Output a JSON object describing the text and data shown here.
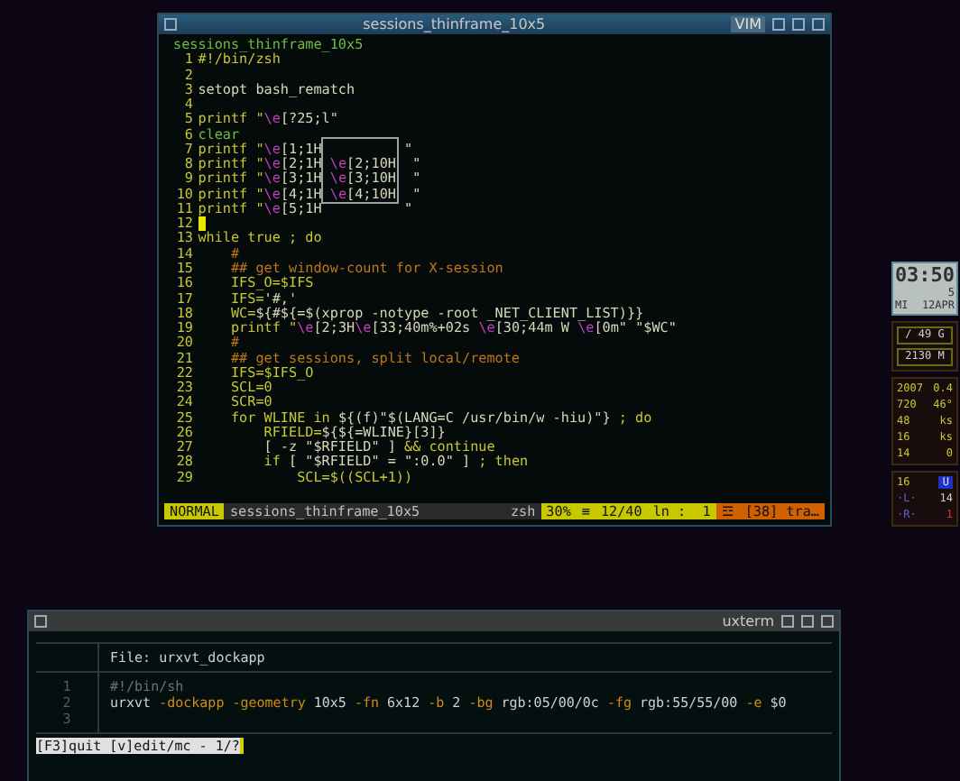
{
  "vim_window": {
    "title": "sessions_thinframe_10x5",
    "app_label": "VIM",
    "buffer_name": "sessions_thinframe_10x5",
    "lines": [
      {
        "number": "1",
        "cursor": false,
        "segments": [
          {
            "text": "#!/bin/zsh",
            "color": "#c8c832"
          }
        ]
      },
      {
        "number": "2",
        "cursor": false
      },
      {
        "number": "3",
        "cursor": false,
        "segments": [
          {
            "text": "setopt bash_rematch",
            "color": "#d8d8b8"
          }
        ]
      },
      {
        "number": "4",
        "cursor": false
      },
      {
        "number": "5",
        "cursor": false,
        "segments": [
          {
            "text": "printf \"",
            "color": "#c8c832"
          },
          {
            "text": "\\e",
            "color": "#c040c0"
          },
          {
            "text": "[?25;l\"",
            "color": "#d8d8b8"
          }
        ]
      },
      {
        "number": "6",
        "cursor": false,
        "segments": [
          {
            "text": "clear",
            "color": "#70c040"
          }
        ]
      },
      {
        "number": "7",
        "cursor": false,
        "segments": [
          {
            "text": "printf \"",
            "color": "#c8c832"
          },
          {
            "text": "\\e",
            "color": "#c040c0"
          },
          {
            "text": "[1;1H          \"",
            "color": "#d8d8b8"
          }
        ]
      },
      {
        "number": "8",
        "cursor": false,
        "segments": [
          {
            "text": "printf \"",
            "color": "#c8c832"
          },
          {
            "text": "\\e",
            "color": "#c040c0"
          },
          {
            "text": "[2;1H ",
            "color": "#d8d8b8"
          },
          {
            "text": "\\e",
            "color": "#c040c0"
          },
          {
            "text": "[2;10H  \"",
            "color": "#d8d8b8"
          }
        ]
      },
      {
        "number": "9",
        "cursor": false,
        "segments": [
          {
            "text": "printf \"",
            "color": "#c8c832"
          },
          {
            "text": "\\e",
            "color": "#c040c0"
          },
          {
            "text": "[3;1H ",
            "color": "#d8d8b8"
          },
          {
            "text": "\\e",
            "color": "#c040c0"
          },
          {
            "text": "[3;10H  \"",
            "color": "#d8d8b8"
          }
        ]
      },
      {
        "number": "10",
        "cursor": false,
        "segments": [
          {
            "text": "printf \"",
            "color": "#c8c832"
          },
          {
            "text": "\\e",
            "color": "#c040c0"
          },
          {
            "text": "[4;1H ",
            "color": "#d8d8b8"
          },
          {
            "text": "\\e",
            "color": "#c040c0"
          },
          {
            "text": "[4;10H  \"",
            "color": "#d8d8b8"
          }
        ]
      },
      {
        "number": "11",
        "cursor": false,
        "segments": [
          {
            "text": "printf \"",
            "color": "#c8c832"
          },
          {
            "text": "\\e",
            "color": "#c040c0"
          },
          {
            "text": "[5;1H          \"",
            "color": "#d8d8b8"
          }
        ]
      },
      {
        "number": "12",
        "cursor": true
      },
      {
        "number": "13",
        "cursor": false,
        "segments": [
          {
            "text": "while true ; do",
            "color": "#c8c832"
          }
        ]
      },
      {
        "number": "14",
        "cursor": false,
        "segments": [
          {
            "text": "    #",
            "color": "#c07818"
          }
        ]
      },
      {
        "number": "15",
        "cursor": false,
        "segments": [
          {
            "text": "    ## get window-count for X-session",
            "color": "#c07818"
          }
        ]
      },
      {
        "number": "16",
        "cursor": false,
        "segments": [
          {
            "text": "    IFS_O=$IFS",
            "color": "#c8c832"
          }
        ]
      },
      {
        "number": "17",
        "cursor": false,
        "segments": [
          {
            "text": "    IFS=",
            "color": "#c8c832"
          },
          {
            "text": "'#,'",
            "color": "#d8d8b8"
          }
        ]
      },
      {
        "number": "18",
        "cursor": false,
        "segments": [
          {
            "text": "    WC=",
            "color": "#c8c832"
          },
          {
            "text": "${#${=$(xprop -notype -root _NET_CLIENT_LIST)}}",
            "color": "#d8d8b8"
          }
        ]
      },
      {
        "number": "19",
        "cursor": false,
        "segments": [
          {
            "text": "    printf \"",
            "color": "#c8c832"
          },
          {
            "text": "\\e",
            "color": "#c040c0"
          },
          {
            "text": "[2;3H",
            "color": "#d8d8b8"
          },
          {
            "text": "\\e",
            "color": "#c040c0"
          },
          {
            "text": "[33;40m%+02s ",
            "color": "#d8d8b8"
          },
          {
            "text": "\\e",
            "color": "#c040c0"
          },
          {
            "text": "[30;44m W ",
            "color": "#d8d8b8"
          },
          {
            "text": "\\e",
            "color": "#c040c0"
          },
          {
            "text": "[0m\" \"$WC\"",
            "color": "#d8d8b8"
          }
        ]
      },
      {
        "number": "20",
        "cursor": false,
        "segments": [
          {
            "text": "    #",
            "color": "#c07818"
          }
        ]
      },
      {
        "number": "21",
        "cursor": false,
        "segments": [
          {
            "text": "    ## get sessions, split local/remote",
            "color": "#c07818"
          }
        ]
      },
      {
        "number": "22",
        "cursor": false,
        "segments": [
          {
            "text": "    IFS=$IFS_O",
            "color": "#c8c832"
          }
        ]
      },
      {
        "number": "23",
        "cursor": false,
        "segments": [
          {
            "text": "    SCL=0",
            "color": "#c8c832"
          }
        ]
      },
      {
        "number": "24",
        "cursor": false,
        "segments": [
          {
            "text": "    SCR=0",
            "color": "#c8c832"
          }
        ]
      },
      {
        "number": "25",
        "cursor": false,
        "segments": [
          {
            "text": "    for WLINE in ",
            "color": "#c8c832"
          },
          {
            "text": "${(f)\"$(LANG=C /usr/bin/w -hiu)\"}",
            "color": "#d8d8b8"
          },
          {
            "text": " ; do",
            "color": "#c8c832"
          }
        ]
      },
      {
        "number": "26",
        "cursor": false,
        "segments": [
          {
            "text": "        RFIELD=",
            "color": "#c8c832"
          },
          {
            "text": "${${=WLINE}[3]}",
            "color": "#d8d8b8"
          }
        ]
      },
      {
        "number": "27",
        "cursor": false,
        "segments": [
          {
            "text": "        [ -z \"$RFIELD\" ] ",
            "color": "#d8d8b8"
          },
          {
            "text": "&& continue",
            "color": "#c8c832"
          }
        ]
      },
      {
        "number": "28",
        "cursor": false,
        "segments": [
          {
            "text": "        if ",
            "color": "#c8c832"
          },
          {
            "text": "[ \"$RFIELD\" = \":0.0\" ] ",
            "color": "#d8d8b8"
          },
          {
            "text": "; then",
            "color": "#c8c832"
          }
        ]
      },
      {
        "number": "29",
        "cursor": false,
        "segments": [
          {
            "text": "            SCL=$((SCL+1))",
            "color": "#c8c832"
          }
        ]
      }
    ],
    "status_bar": {
      "mode": "NORMAL",
      "file": "sessions_thinframe_10x5",
      "filetype": "zsh",
      "percent": "30%",
      "percent_icon": "≡",
      "position": "12/40",
      "line_col": "ln :  1",
      "warning_icon": "☲",
      "warning": "[38] tra…"
    }
  },
  "dock": {
    "clock": {
      "time": "03:50",
      "seconds": "5",
      "day": "MI",
      "date": "12APR"
    },
    "disk": [
      "/ 49 G",
      "2130 M"
    ],
    "stats": [
      [
        "2007",
        "0.4"
      ],
      [
        "720",
        "46°"
      ],
      [
        "48",
        "ks"
      ],
      [
        "16",
        "ks"
      ],
      [
        "14",
        "0"
      ]
    ],
    "sessions": {
      "count": "16",
      "badge": "U",
      "local_label": "·L·",
      "local": "14",
      "remote_label": "·R·",
      "remote": "1"
    }
  },
  "uxterm_window": {
    "title": "uxterm",
    "file_header": "File: urxvt_dockapp",
    "lines": [
      {
        "number": "1",
        "segments": [
          {
            "text": "#!/bin/sh",
            "color": "#707070"
          }
        ]
      },
      {
        "number": "2",
        "segments": [
          {
            "text": "urxvt ",
            "color": "#d0d0d0"
          },
          {
            "text": "-dockapp -geometry ",
            "color": "#d08a10"
          },
          {
            "text": "10x5 ",
            "color": "#d0d0d0"
          },
          {
            "text": "-fn ",
            "color": "#d08a10"
          },
          {
            "text": "6x12 ",
            "color": "#d0d0d0"
          },
          {
            "text": "-b ",
            "color": "#d08a10"
          },
          {
            "text": "2 ",
            "color": "#d0d0d0"
          },
          {
            "text": "-bg ",
            "color": "#d08a10"
          },
          {
            "text": "rgb:05/00/0c ",
            "color": "#d0d0d0"
          },
          {
            "text": "-fg ",
            "color": "#d08a10"
          },
          {
            "text": "rgb:55/55/00 ",
            "color": "#d0d0d0"
          },
          {
            "text": "-e ",
            "color": "#d08a10"
          },
          {
            "text": "$0",
            "color": "#d0d0d0"
          }
        ]
      },
      {
        "number": "3"
      }
    ],
    "prompt": "[F3]quit [v]edit/mc - 1/?"
  }
}
